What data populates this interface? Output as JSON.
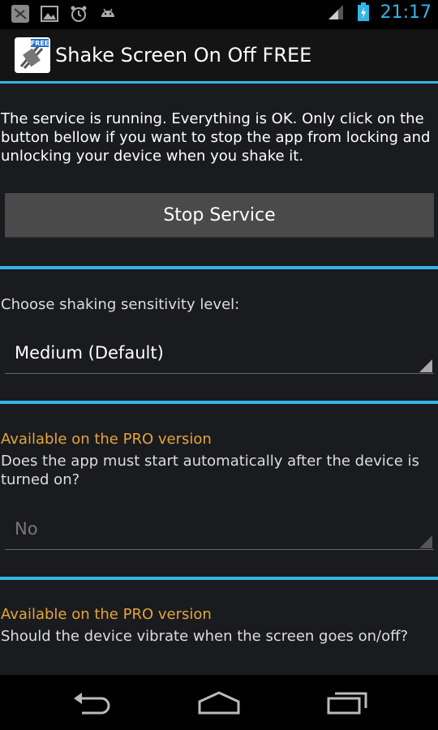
{
  "status_bar": {
    "time": "21:17",
    "icons": [
      "app-notification-icon",
      "image-icon",
      "alarm-icon",
      "android-icon",
      "signal-icon",
      "battery-charging-icon"
    ]
  },
  "action_bar": {
    "title": "Shake Screen On Off FREE",
    "icon_badge": "FREE"
  },
  "service": {
    "message": "The service is running. Everything is OK. Only click on the button bellow if you want to stop the app from locking and unlocking your device when you shake it.",
    "button_label": "Stop Service"
  },
  "sensitivity": {
    "label": "Choose shaking sensitivity level:",
    "selected": "Medium (Default)"
  },
  "autostart": {
    "pro_label": "Available on the PRO version",
    "question": "Does the app must start automatically after the device is turned on?",
    "selected": "No"
  },
  "vibrate": {
    "pro_label": "Available on the PRO version",
    "question": "Should the device vibrate when the screen goes on/off?"
  },
  "nav": [
    "back-icon",
    "home-icon",
    "recent-apps-icon"
  ],
  "colors": {
    "accent": "#33b5e5",
    "pro": "#e5a53a",
    "background": "#1a1b1e"
  }
}
